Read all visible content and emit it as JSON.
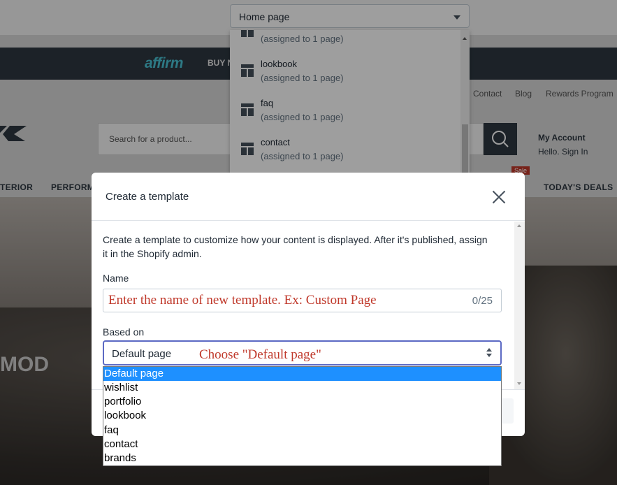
{
  "editor": {
    "page_select_value": "Home page"
  },
  "page_list": {
    "items": [
      {
        "name": "",
        "sub": "(assigned to 1 page)"
      },
      {
        "name": "lookbook",
        "sub": "(assigned to 1 page)"
      },
      {
        "name": "faq",
        "sub": "(assigned to 1 page)"
      },
      {
        "name": "contact",
        "sub": "(assigned to 1 page)"
      }
    ]
  },
  "store": {
    "affirm_logo": "affirm",
    "promo_text": "BUY N",
    "top_links": [
      "Contact",
      "Blog",
      "Rewards Program"
    ],
    "search_placeholder": "Search for a product...",
    "account_title": "My Account",
    "account_sub": "Hello. Sign In",
    "sale_badge": "Sale",
    "nav": [
      "TERIOR",
      "PERFORM",
      "TODAY'S DEALS"
    ],
    "hero_text": "MOD"
  },
  "modal": {
    "title": "Create a template",
    "description": "Create a template to customize how your content is displayed. After it's published, assign it in the Shopify admin.",
    "name_label": "Name",
    "name_placeholder": "Enter the name of new template. Ex: Custom Page",
    "name_counter": "0/25",
    "based_on_label": "Based on",
    "based_on_value": "Default page",
    "based_on_annotation": "Choose \"Default page\""
  },
  "based_on_options": [
    "Default page",
    "wishlist",
    "portfolio",
    "lookbook",
    "faq",
    "contact",
    "brands"
  ],
  "colors": {
    "annotation": "#c0392b",
    "selected_option": "#1e90ff",
    "focus_border": "#5c6ac4"
  }
}
